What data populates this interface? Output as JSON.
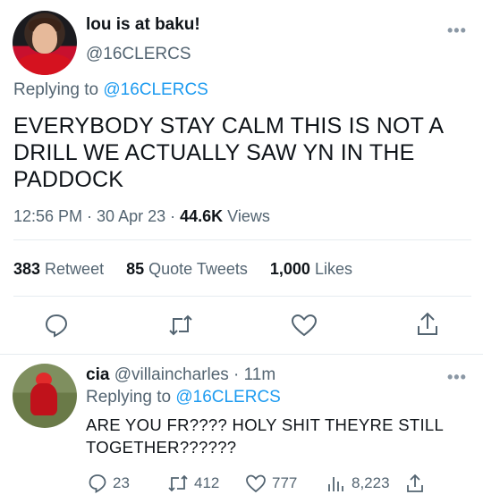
{
  "tweet": {
    "display_name": "lou is at baku!",
    "handle": "@16CLERCS",
    "replying_prefix": "Replying to ",
    "replying_handle": "@16CLERCS",
    "text": "EVERYBODY STAY CALM THIS IS NOT A DRILL WE ACTUALLY SAW YN IN THE PADDOCK",
    "time": "12:56 PM",
    "sep1": " · ",
    "date": "30 Apr 23",
    "sep2": " · ",
    "views_count": "44.6K",
    "views_label": " Views",
    "retweets_count": "383",
    "retweets_label": " Retweet",
    "quotes_count": "85",
    "quotes_label": " Quote Tweets",
    "likes_count": "1,000",
    "likes_label": " Likes",
    "more_icon": "•••"
  },
  "reply": {
    "display_name": "cia",
    "handle": " @villaincharles",
    "time": " · 11m",
    "replying_prefix": "Replying to ",
    "replying_handle": "@16CLERCS",
    "text_line1": "ARE YOU FR???? HOLY SHIT THEYRE STILL",
    "text_line2": "TOGETHER??????",
    "reply_count": "23",
    "retweet_count": "412",
    "like_count": "777",
    "view_count": "8,223",
    "more_icon": "•••"
  },
  "colors": {
    "link": "#1d9bf0",
    "secondary_text": "#536471",
    "primary_text": "#0f1419",
    "divider": "#e6ecf0"
  },
  "icons": [
    "reply-icon",
    "retweet-icon",
    "like-icon",
    "share-icon",
    "views-icon",
    "more-icon"
  ]
}
